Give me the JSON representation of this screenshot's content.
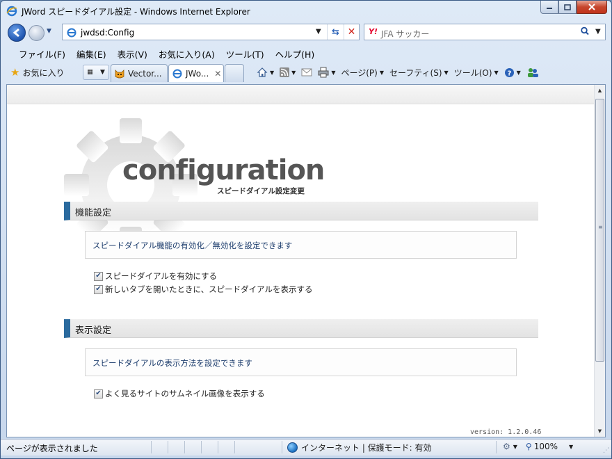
{
  "window": {
    "title": "JWord スピードダイアル設定 - Windows Internet Explorer"
  },
  "address": {
    "url": "jwdsd:Config"
  },
  "search": {
    "logo": "Y!",
    "placeholder": "JFA サッカー"
  },
  "menu": {
    "items": [
      "ファイル(F)",
      "編集(E)",
      "表示(V)",
      "お気に入り(A)",
      "ツール(T)",
      "ヘルプ(H)"
    ]
  },
  "favorites": {
    "label": "お気に入り"
  },
  "tabs": [
    {
      "label": "Vector...",
      "active": false
    },
    {
      "label": "JWo...",
      "active": true
    }
  ],
  "commands": {
    "page": "ページ(P)",
    "safety": "セーフティ(S)",
    "tools": "ツール(O)"
  },
  "page": {
    "brand": "configuration",
    "brand_sub": "スピードダイアル設定変更",
    "sections": [
      {
        "title": "機能設定",
        "description": "スピードダイアル機能の有効化／無効化を設定できます",
        "options": [
          {
            "label": "スピードダイアルを有効にする",
            "checked": true
          },
          {
            "label": "新しいタブを開いたときに、スピードダイアルを表示する",
            "checked": true
          }
        ]
      },
      {
        "title": "表示設定",
        "description": "スピードダイアルの表示方法を設定できます",
        "options": [
          {
            "label": "よく見るサイトのサムネイル画像を表示する",
            "checked": true
          }
        ]
      }
    ],
    "version": "version: 1.2.0.46"
  },
  "status": {
    "text": "ページが表示されました",
    "zone": "インターネット | 保護モード: 有効",
    "zoom": "100%"
  },
  "colors": {
    "section_accent": "#2a6a9e",
    "description_text": "#1e3e6e"
  }
}
